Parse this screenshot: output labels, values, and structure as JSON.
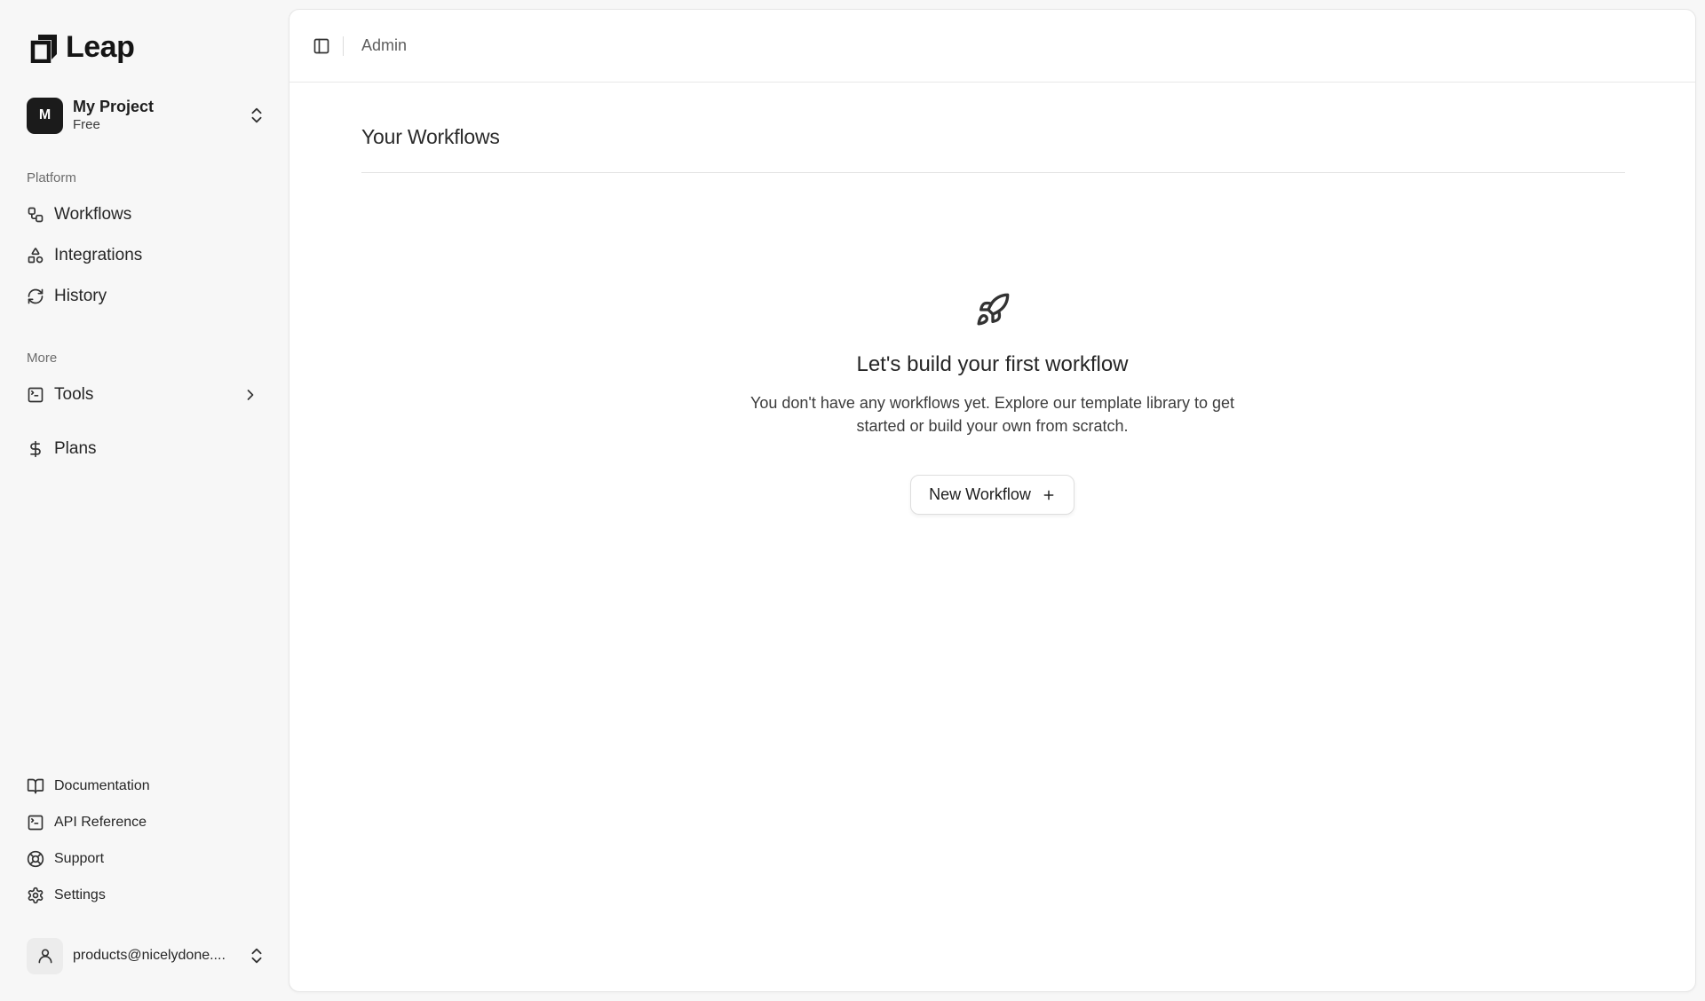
{
  "brand": {
    "name": "Leap"
  },
  "project": {
    "initial": "M",
    "name": "My Project",
    "plan": "Free"
  },
  "sidebar": {
    "platform_label": "Platform",
    "platform_items": [
      {
        "label": "Workflows",
        "icon": "workflow-icon"
      },
      {
        "label": "Integrations",
        "icon": "shapes-icon"
      },
      {
        "label": "History",
        "icon": "refresh-icon"
      }
    ],
    "more_label": "More",
    "more_items": [
      {
        "label": "Tools",
        "icon": "terminal-icon"
      },
      {
        "label": "Plans",
        "icon": "dollar-icon"
      }
    ],
    "footer_items": [
      {
        "label": "Documentation",
        "icon": "book-icon"
      },
      {
        "label": "API Reference",
        "icon": "terminal-icon"
      },
      {
        "label": "Support",
        "icon": "lifebuoy-icon"
      },
      {
        "label": "Settings",
        "icon": "gear-icon"
      }
    ]
  },
  "user": {
    "email": "products@nicelydone...."
  },
  "topbar": {
    "breadcrumb": "Admin"
  },
  "main": {
    "title": "Your Workflows",
    "empty_state": {
      "icon": "rocket-icon",
      "title": "Let's build your first workflow",
      "description": "You don't have any workflows yet. Explore our template library to get started or build your own from scratch.",
      "button_label": "New Workflow"
    }
  }
}
